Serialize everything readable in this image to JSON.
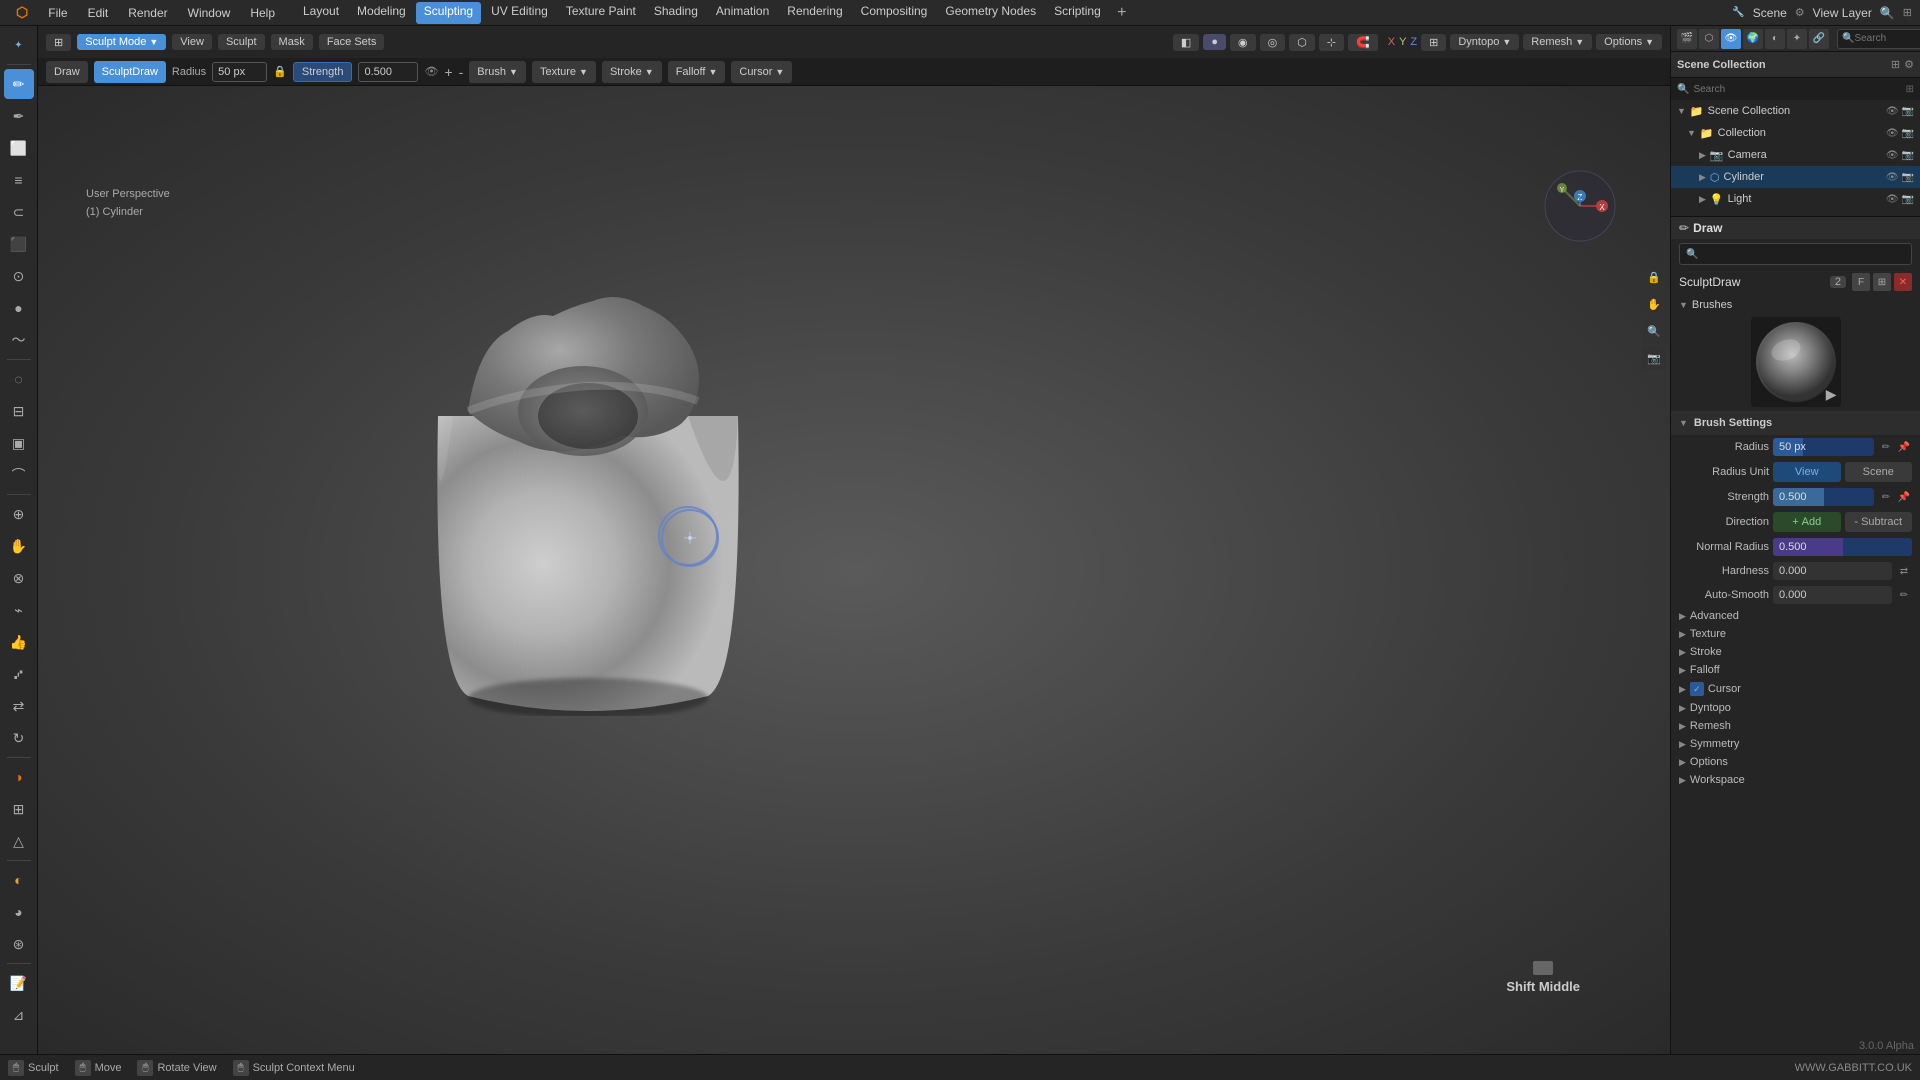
{
  "app": {
    "title": "Blender",
    "version": "3.0.0 Alpha"
  },
  "menubar": {
    "items": [
      "Blender",
      "File",
      "Edit",
      "Render",
      "Window",
      "Help"
    ],
    "layout_items": [
      "Layout",
      "Modeling",
      "Sculpting",
      "UV Editing",
      "Texture Paint",
      "Shading",
      "Animation",
      "Rendering",
      "Compositing",
      "Geometry Nodes",
      "Scripting"
    ],
    "active": "Sculpting",
    "scene_label": "Scene",
    "view_layer_label": "View Layer",
    "add_icon": "+"
  },
  "tabs": {
    "items": [
      "Layout",
      "Modeling",
      "Sculpting",
      "UV Editing",
      "Texture Paint",
      "Shading",
      "Animation",
      "Rendering",
      "Compositing",
      "Geometry Nodes",
      "Scripting"
    ],
    "active": "Sculpting"
  },
  "header": {
    "mode": "Sculpt Mode",
    "draw_mode": "Draw",
    "brush_label": "SculptDraw",
    "radius_label": "Radius",
    "radius_value": "50 px",
    "strength_label": "Strength",
    "strength_value": "0.500",
    "brush_menu": "Brush",
    "texture_menu": "Texture",
    "stroke_menu": "Stroke",
    "falloff_menu": "Falloff",
    "cursor_menu": "Cursor",
    "dyntopo_label": "Dyntopo",
    "remesh_label": "Remesh",
    "options_label": "Options"
  },
  "viewport": {
    "perspective_label": "User Perspective",
    "object_label": "(1) Cylinder",
    "view_menu": "View",
    "sculpt_menu": "Sculpt",
    "mask_menu": "Mask",
    "face_sets_menu": "Face Sets"
  },
  "gizmo": {
    "axes": [
      "X",
      "Y",
      "Z"
    ]
  },
  "outliner": {
    "title": "Scene Collection",
    "search_placeholder": "Search",
    "items": [
      {
        "id": "scene_collection",
        "label": "Scene Collection",
        "level": 0,
        "icon": "collection",
        "expanded": true
      },
      {
        "id": "collection",
        "label": "Collection",
        "level": 1,
        "icon": "collection",
        "expanded": true
      },
      {
        "id": "camera",
        "label": "Camera",
        "level": 2,
        "icon": "camera"
      },
      {
        "id": "cylinder",
        "label": "Cylinder",
        "level": 2,
        "icon": "mesh",
        "selected": true
      },
      {
        "id": "light",
        "label": "Light",
        "level": 2,
        "icon": "light"
      }
    ]
  },
  "properties": {
    "brush_name": "Draw",
    "brushes_label": "Brushes",
    "brush_id": "SculptDraw",
    "brush_num": "2",
    "brush_settings_label": "Brush Settings",
    "radius_label": "Radius",
    "radius_value": "50 px",
    "radius_unit_label": "Radius Unit",
    "radius_unit_view": "View",
    "radius_unit_scene": "Scene",
    "strength_label": "Strength",
    "strength_value": "0.500",
    "direction_label": "Direction",
    "direction_add": "Add",
    "direction_sub": "Subtract",
    "normal_radius_label": "Normal Radius",
    "normal_radius_value": "0.500",
    "hardness_label": "Hardness",
    "hardness_value": "0.000",
    "auto_smooth_label": "Auto-Smooth",
    "auto_smooth_value": "0.000",
    "sections": [
      {
        "id": "advanced",
        "label": "Advanced",
        "expanded": false
      },
      {
        "id": "texture",
        "label": "Texture",
        "expanded": false
      },
      {
        "id": "stroke",
        "label": "Stroke",
        "expanded": false
      },
      {
        "id": "falloff",
        "label": "Falloff",
        "expanded": false
      },
      {
        "id": "cursor",
        "label": "Cursor",
        "expanded": true,
        "has_check": true
      },
      {
        "id": "dyntopo",
        "label": "Dyntopo",
        "expanded": false
      },
      {
        "id": "remesh",
        "label": "Remesh",
        "expanded": false
      },
      {
        "id": "symmetry",
        "label": "Symmetry",
        "expanded": false
      },
      {
        "id": "options",
        "label": "Options",
        "expanded": false
      },
      {
        "id": "workspace",
        "label": "Workspace",
        "expanded": false
      }
    ]
  },
  "statusbar": {
    "sculpt_label": "Sculpt",
    "move_label": "Move",
    "rotate_view_label": "Rotate View",
    "context_menu_label": "Sculpt Context Menu",
    "watermark": "WWW.GABBITT.CO.UK"
  },
  "keyboard_hint": {
    "label": "Shift Middle"
  },
  "icons": {
    "search": "🔍",
    "eye": "👁",
    "camera": "📷",
    "mesh": "⬡",
    "light": "💡",
    "collection": "📁",
    "pencil": "✏",
    "chevron_right": "▶",
    "chevron_down": "▼",
    "plus": "+",
    "minus": "-",
    "x": "✕",
    "check": "✓",
    "copy": "⊞",
    "link": "🔗",
    "cursor": "⊹"
  }
}
